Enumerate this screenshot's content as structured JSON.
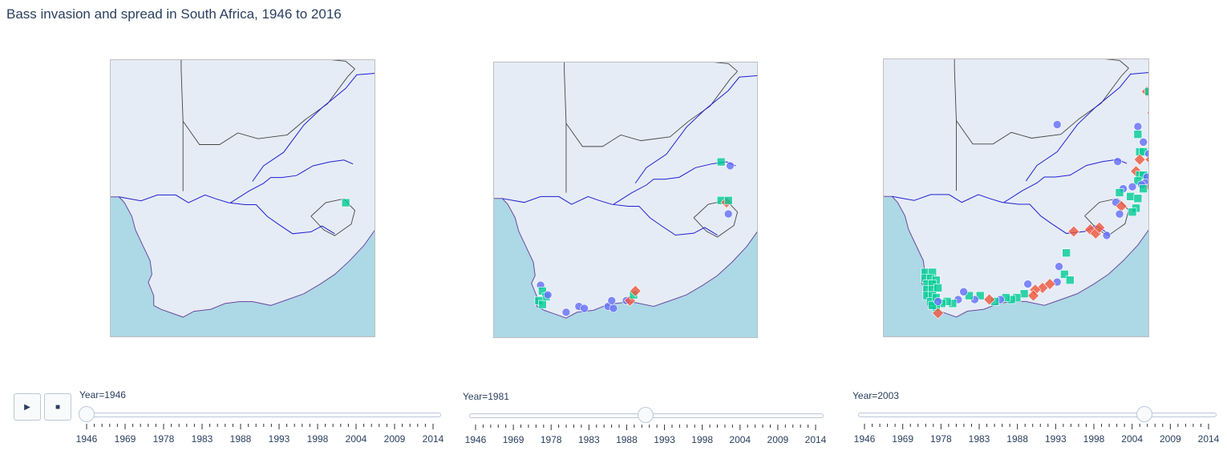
{
  "title": "Bass invasion and spread in South Africa, 1946 to 2016",
  "colors": {
    "land": "#e5ecf6",
    "ocean": "#add8e6",
    "river": "#1f1fcf",
    "border": "#444444",
    "coast": "#6a4aa0",
    "c1": "#636efa",
    "c2": "#ef553b",
    "c3": "#00cc96",
    "frame": "#bfbfbf"
  },
  "controls": {
    "play_icon": "play-icon",
    "stop_icon": "stop-icon"
  },
  "tick_labels": [
    "1946",
    "1969",
    "1978",
    "1983",
    "1988",
    "1993",
    "1998",
    "2004",
    "2009",
    "2014"
  ],
  "panels": [
    {
      "label": "Year=1946",
      "value": 1946
    },
    {
      "label": "Year=1981",
      "value": 1981
    },
    {
      "label": "Year=2003",
      "value": 2003
    }
  ],
  "chart_data": {
    "type": "scatter",
    "xlabel": "",
    "ylabel": "",
    "categories": [
      "circle",
      "diamond",
      "square"
    ],
    "frames": [
      {
        "year": 1946,
        "points": [
          {
            "lon": 28.9,
            "lat": -28.9,
            "symbol": "square"
          }
        ]
      },
      {
        "year": 1981,
        "points": [
          {
            "lon": 18.6,
            "lat": -33.1,
            "symbol": "circle"
          },
          {
            "lon": 18.7,
            "lat": -33.4,
            "symbol": "square"
          },
          {
            "lon": 18.9,
            "lat": -33.7,
            "symbol": "square"
          },
          {
            "lon": 18.5,
            "lat": -33.9,
            "symbol": "square"
          },
          {
            "lon": 18.7,
            "lat": -34.1,
            "symbol": "square"
          },
          {
            "lon": 19.0,
            "lat": -33.6,
            "symbol": "circle"
          },
          {
            "lon": 20.0,
            "lat": -34.5,
            "symbol": "circle"
          },
          {
            "lon": 20.7,
            "lat": -34.2,
            "symbol": "circle"
          },
          {
            "lon": 21.0,
            "lat": -34.3,
            "symbol": "circle"
          },
          {
            "lon": 22.3,
            "lat": -34.2,
            "symbol": "circle"
          },
          {
            "lon": 22.5,
            "lat": -33.9,
            "symbol": "circle"
          },
          {
            "lon": 22.6,
            "lat": -34.3,
            "symbol": "circle"
          },
          {
            "lon": 23.3,
            "lat": -33.9,
            "symbol": "circle"
          },
          {
            "lon": 23.5,
            "lat": -33.9,
            "symbol": "diamond"
          },
          {
            "lon": 23.7,
            "lat": -33.6,
            "symbol": "square"
          },
          {
            "lon": 23.8,
            "lat": -33.4,
            "symbol": "diamond"
          },
          {
            "lon": 28.5,
            "lat": -26.7,
            "symbol": "square"
          },
          {
            "lon": 29.0,
            "lat": -26.9,
            "symbol": "circle"
          },
          {
            "lon": 28.5,
            "lat": -28.7,
            "symbol": "square"
          },
          {
            "lon": 28.8,
            "lat": -28.8,
            "symbol": "diamond"
          },
          {
            "lon": 28.9,
            "lat": -28.7,
            "symbol": "square"
          },
          {
            "lon": 28.9,
            "lat": -29.4,
            "symbol": "circle"
          }
        ]
      },
      {
        "year": 2003,
        "points": [
          {
            "lon": 30.4,
            "lat": -23.2,
            "symbol": "diamond"
          },
          {
            "lon": 30.5,
            "lat": -23.2,
            "symbol": "square"
          },
          {
            "lon": 30.7,
            "lat": -24.3,
            "symbol": "diamond"
          },
          {
            "lon": 30.8,
            "lat": -24.9,
            "symbol": "square"
          },
          {
            "lon": 29.9,
            "lat": -25.0,
            "symbol": "circle"
          },
          {
            "lon": 29.9,
            "lat": -25.4,
            "symbol": "square"
          },
          {
            "lon": 25.5,
            "lat": -24.9,
            "symbol": "circle"
          },
          {
            "lon": 30.2,
            "lat": -25.8,
            "symbol": "circle"
          },
          {
            "lon": 30.0,
            "lat": -26.3,
            "symbol": "square"
          },
          {
            "lon": 30.2,
            "lat": -26.3,
            "symbol": "square"
          },
          {
            "lon": 30.5,
            "lat": -26.4,
            "symbol": "circle"
          },
          {
            "lon": 30.6,
            "lat": -26.7,
            "symbol": "diamond"
          },
          {
            "lon": 30.0,
            "lat": -26.7,
            "symbol": "diamond"
          },
          {
            "lon": 28.8,
            "lat": -26.8,
            "symbol": "circle"
          },
          {
            "lon": 30.7,
            "lat": -27.1,
            "symbol": "circle"
          },
          {
            "lon": 29.8,
            "lat": -27.3,
            "symbol": "diamond"
          },
          {
            "lon": 30.0,
            "lat": -27.5,
            "symbol": "square"
          },
          {
            "lon": 30.2,
            "lat": -27.5,
            "symbol": "square"
          },
          {
            "lon": 30.4,
            "lat": -27.6,
            "symbol": "circle"
          },
          {
            "lon": 29.9,
            "lat": -27.8,
            "symbol": "square"
          },
          {
            "lon": 30.3,
            "lat": -27.9,
            "symbol": "circle"
          },
          {
            "lon": 30.1,
            "lat": -28.0,
            "symbol": "circle"
          },
          {
            "lon": 29.6,
            "lat": -28.1,
            "symbol": "circle"
          },
          {
            "lon": 30.6,
            "lat": -28.1,
            "symbol": "diamond"
          },
          {
            "lon": 29.1,
            "lat": -28.2,
            "symbol": "circle"
          },
          {
            "lon": 30.2,
            "lat": -28.2,
            "symbol": "square"
          },
          {
            "lon": 28.9,
            "lat": -28.4,
            "symbol": "square"
          },
          {
            "lon": 29.5,
            "lat": -28.6,
            "symbol": "square"
          },
          {
            "lon": 29.9,
            "lat": -28.7,
            "symbol": "square"
          },
          {
            "lon": 28.7,
            "lat": -28.9,
            "symbol": "circle"
          },
          {
            "lon": 29.0,
            "lat": -29.1,
            "symbol": "diamond"
          },
          {
            "lon": 29.8,
            "lat": -29.2,
            "symbol": "square"
          },
          {
            "lon": 29.6,
            "lat": -29.4,
            "symbol": "square"
          },
          {
            "lon": 28.9,
            "lat": -29.5,
            "symbol": "circle"
          },
          {
            "lon": 26.4,
            "lat": -30.4,
            "symbol": "diamond"
          },
          {
            "lon": 27.3,
            "lat": -30.3,
            "symbol": "diamond"
          },
          {
            "lon": 27.6,
            "lat": -30.5,
            "symbol": "diamond"
          },
          {
            "lon": 27.8,
            "lat": -30.2,
            "symbol": "diamond"
          },
          {
            "lon": 28.2,
            "lat": -30.6,
            "symbol": "circle"
          },
          {
            "lon": 26.0,
            "lat": -31.5,
            "symbol": "square"
          },
          {
            "lon": 25.6,
            "lat": -32.2,
            "symbol": "circle"
          },
          {
            "lon": 25.9,
            "lat": -32.6,
            "symbol": "square"
          },
          {
            "lon": 26.2,
            "lat": -32.9,
            "symbol": "square"
          },
          {
            "lon": 25.5,
            "lat": -33.0,
            "symbol": "circle"
          },
          {
            "lon": 25.1,
            "lat": -33.1,
            "symbol": "diamond"
          },
          {
            "lon": 24.7,
            "lat": -33.3,
            "symbol": "diamond"
          },
          {
            "lon": 23.9,
            "lat": -33.1,
            "symbol": "circle"
          },
          {
            "lon": 24.3,
            "lat": -33.4,
            "symbol": "diamond"
          },
          {
            "lon": 24.2,
            "lat": -33.7,
            "symbol": "diamond"
          },
          {
            "lon": 23.7,
            "lat": -33.6,
            "symbol": "square"
          },
          {
            "lon": 23.3,
            "lat": -33.8,
            "symbol": "square"
          },
          {
            "lon": 23.0,
            "lat": -33.9,
            "symbol": "square"
          },
          {
            "lon": 22.7,
            "lat": -33.8,
            "symbol": "square"
          },
          {
            "lon": 22.4,
            "lat": -33.9,
            "symbol": "circle"
          },
          {
            "lon": 22.1,
            "lat": -34.0,
            "symbol": "square"
          },
          {
            "lon": 21.8,
            "lat": -33.9,
            "symbol": "diamond"
          },
          {
            "lon": 21.3,
            "lat": -33.7,
            "symbol": "square"
          },
          {
            "lon": 21.0,
            "lat": -33.9,
            "symbol": "circle"
          },
          {
            "lon": 20.7,
            "lat": -33.7,
            "symbol": "square"
          },
          {
            "lon": 20.4,
            "lat": -33.5,
            "symbol": "circle"
          },
          {
            "lon": 20.1,
            "lat": -33.9,
            "symbol": "circle"
          },
          {
            "lon": 19.8,
            "lat": -34.1,
            "symbol": "square"
          },
          {
            "lon": 19.5,
            "lat": -34.0,
            "symbol": "square"
          },
          {
            "lon": 19.2,
            "lat": -34.1,
            "symbol": "square"
          },
          {
            "lon": 18.9,
            "lat": -34.3,
            "symbol": "square"
          },
          {
            "lon": 19.0,
            "lat": -34.6,
            "symbol": "diamond"
          },
          {
            "lon": 18.3,
            "lat": -32.5,
            "symbol": "square"
          },
          {
            "lon": 18.7,
            "lat": -32.5,
            "symbol": "square"
          },
          {
            "lon": 18.3,
            "lat": -32.8,
            "symbol": "square"
          },
          {
            "lon": 18.6,
            "lat": -32.8,
            "symbol": "square"
          },
          {
            "lon": 18.9,
            "lat": -32.9,
            "symbol": "square"
          },
          {
            "lon": 18.4,
            "lat": -33.1,
            "symbol": "square"
          },
          {
            "lon": 18.7,
            "lat": -33.1,
            "symbol": "square"
          },
          {
            "lon": 18.4,
            "lat": -33.4,
            "symbol": "square"
          },
          {
            "lon": 18.7,
            "lat": -33.4,
            "symbol": "square"
          },
          {
            "lon": 19.0,
            "lat": -33.3,
            "symbol": "square"
          },
          {
            "lon": 18.4,
            "lat": -33.7,
            "symbol": "square"
          },
          {
            "lon": 18.7,
            "lat": -33.7,
            "symbol": "square"
          },
          {
            "lon": 18.6,
            "lat": -34.0,
            "symbol": "square"
          },
          {
            "lon": 18.9,
            "lat": -33.8,
            "symbol": "square"
          },
          {
            "lon": 18.7,
            "lat": -34.2,
            "symbol": "square"
          },
          {
            "lon": 19.0,
            "lat": -34.0,
            "symbol": "circle"
          }
        ]
      }
    ]
  }
}
